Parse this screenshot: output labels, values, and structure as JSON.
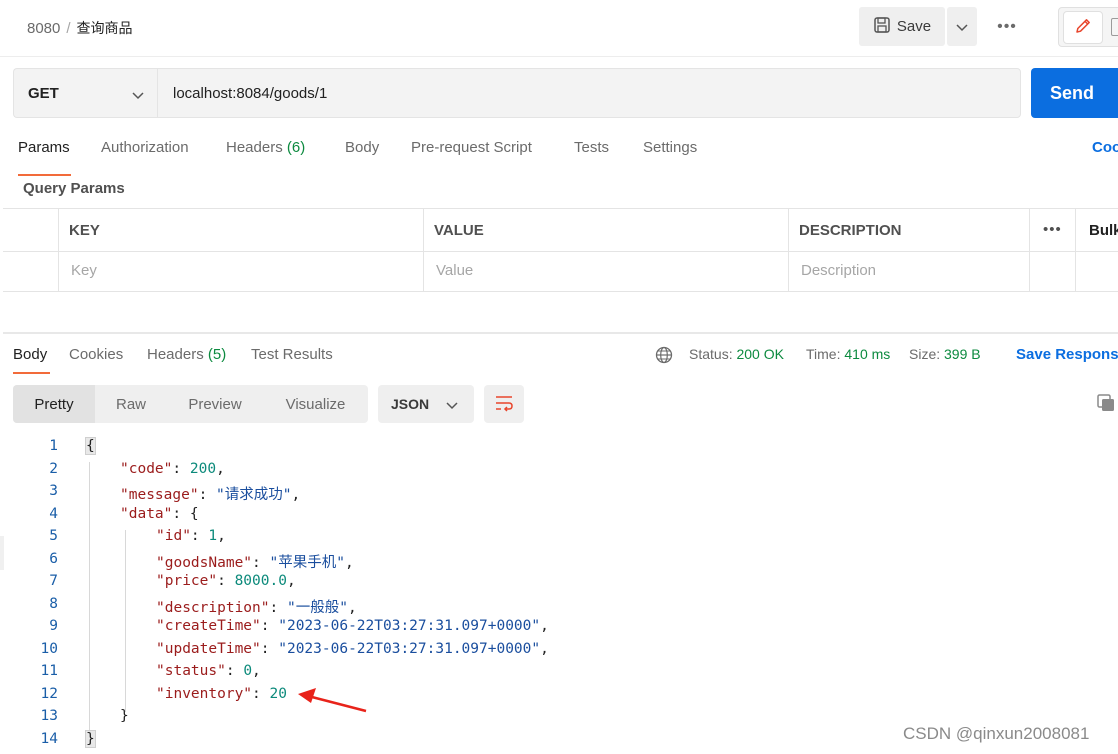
{
  "header": {
    "collection": "8080",
    "separator": "/",
    "request_name": "查询商品",
    "save_label": "Save",
    "more_label": "•••"
  },
  "request": {
    "method": "GET",
    "url": "localhost:8084/goods/1",
    "send_label": "Send",
    "tabs": [
      {
        "label": "Params"
      },
      {
        "label": "Authorization"
      },
      {
        "label": "Headers",
        "count": "(6)"
      },
      {
        "label": "Body"
      },
      {
        "label": "Pre-request Script"
      },
      {
        "label": "Tests"
      },
      {
        "label": "Settings"
      }
    ],
    "code_link": "Coo"
  },
  "query_params": {
    "title": "Query Params",
    "columns": [
      "KEY",
      "VALUE",
      "DESCRIPTION"
    ],
    "placeholders": {
      "key": "Key",
      "value": "Value",
      "description": "Description"
    },
    "more_label": "•••",
    "bulk_label": "Bulk"
  },
  "response": {
    "tabs": [
      {
        "label": "Body"
      },
      {
        "label": "Cookies"
      },
      {
        "label": "Headers",
        "count": "(5)"
      },
      {
        "label": "Test Results"
      }
    ],
    "status_label": "Status:",
    "status_value": "200 OK",
    "time_label": "Time:",
    "time_value": "410 ms",
    "size_label": "Size:",
    "size_value": "399 B",
    "save_response": "Save Respons",
    "view_modes": [
      "Pretty",
      "Raw",
      "Preview",
      "Visualize"
    ],
    "format": "JSON",
    "lines": [
      {
        "n": "1",
        "text": "{"
      },
      {
        "n": "2",
        "key": "\"code\"",
        "value": "200",
        "type": "num",
        "comma": ","
      },
      {
        "n": "3",
        "key": "\"message\"",
        "value": "\"请求成功\"",
        "type": "str",
        "comma": ","
      },
      {
        "n": "4",
        "key": "\"data\"",
        "value": "{",
        "type": "punct",
        "comma": ""
      },
      {
        "n": "5",
        "key": "\"id\"",
        "value": "1",
        "type": "num",
        "comma": ","
      },
      {
        "n": "6",
        "key": "\"goodsName\"",
        "value": "\"苹果手机\"",
        "type": "str",
        "comma": ","
      },
      {
        "n": "7",
        "key": "\"price\"",
        "value": "8000.0",
        "type": "num",
        "comma": ","
      },
      {
        "n": "8",
        "key": "\"description\"",
        "value": "\"一般般\"",
        "type": "str",
        "comma": ","
      },
      {
        "n": "9",
        "key": "\"createTime\"",
        "value": "\"2023-06-22T03:27:31.097+0000\"",
        "type": "str",
        "comma": ","
      },
      {
        "n": "10",
        "key": "\"updateTime\"",
        "value": "\"2023-06-22T03:27:31.097+0000\"",
        "type": "str",
        "comma": ","
      },
      {
        "n": "11",
        "key": "\"status\"",
        "value": "0",
        "type": "num",
        "comma": ","
      },
      {
        "n": "12",
        "key": "\"inventory\"",
        "value": "20",
        "type": "num",
        "comma": ""
      },
      {
        "n": "13",
        "text": "}"
      },
      {
        "n": "14",
        "text": "}"
      }
    ]
  },
  "watermark": "CSDN @qinxun2008081",
  "colors": {
    "accent_blue": "#0b6ee0",
    "tab_underline": "#f26b3a",
    "status_green": "#0c8a3f",
    "annotation_arrow": "#e8231a"
  },
  "icons": [
    "save-icon",
    "chevron-down-icon",
    "pencil-icon",
    "document-icon",
    "globe-icon",
    "wrap-lines-icon",
    "copy-icon",
    "red-arrow-annotation"
  ]
}
